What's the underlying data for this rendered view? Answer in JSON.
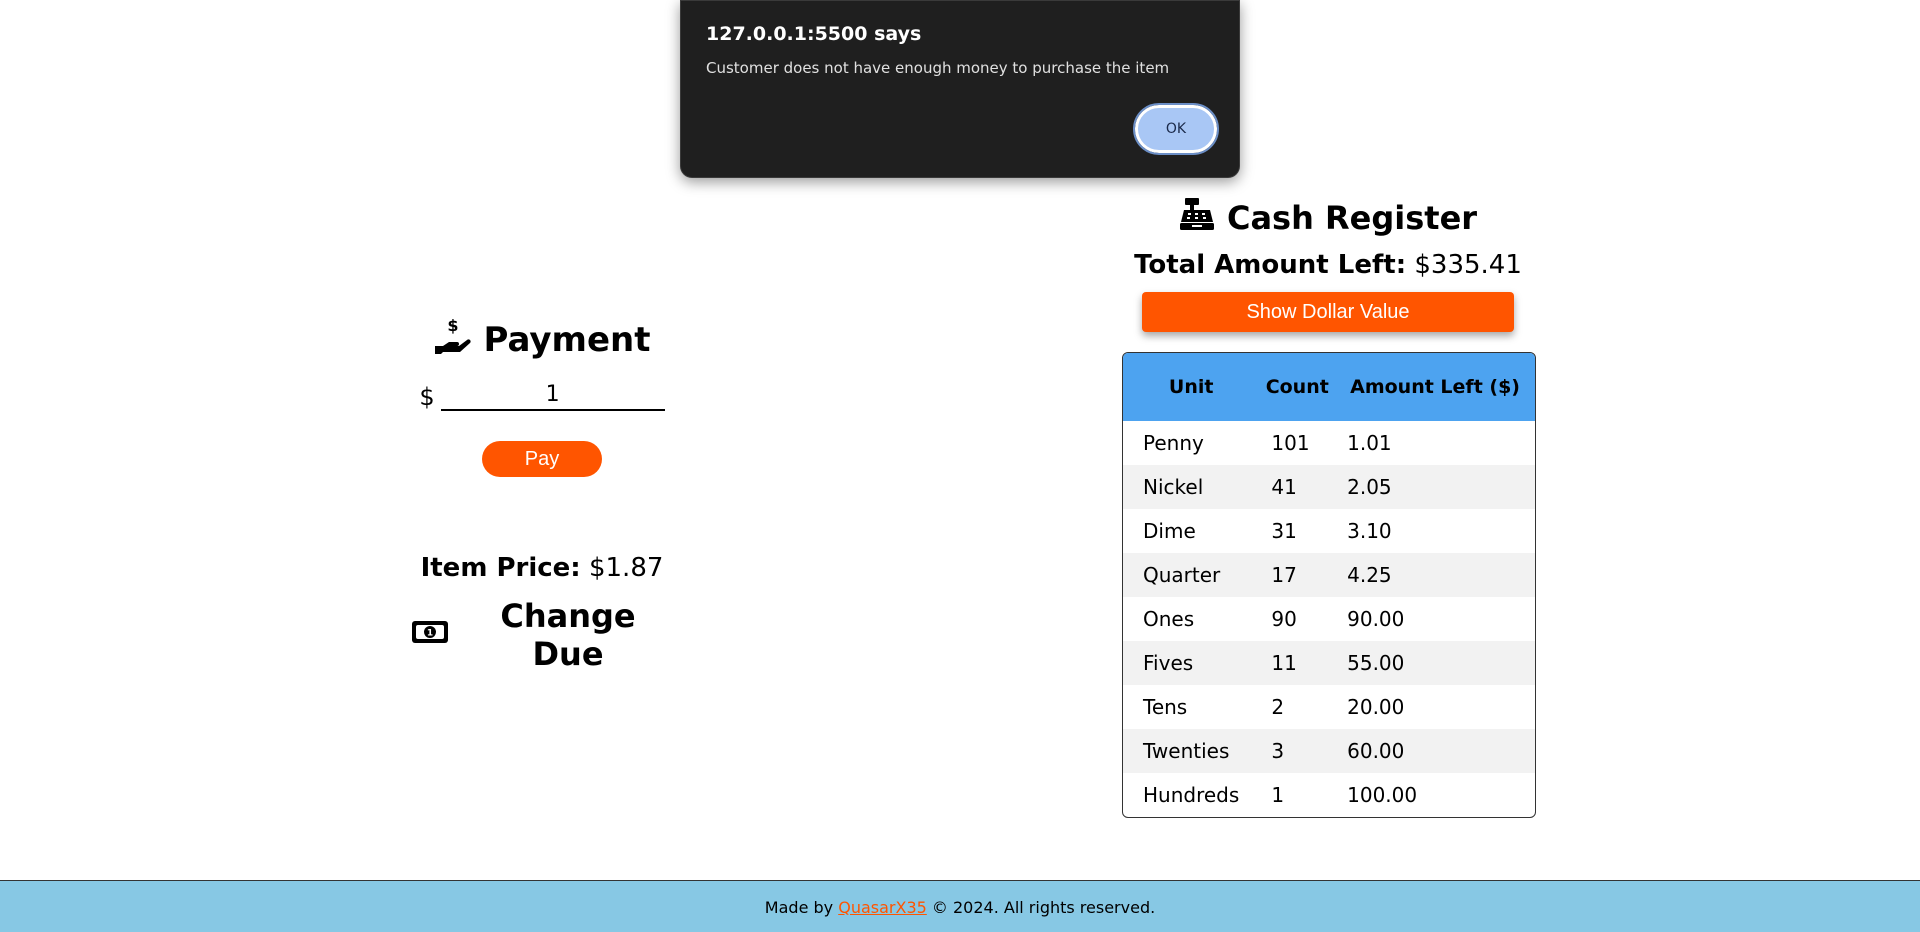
{
  "dialog": {
    "title": "127.0.0.1:5500 says",
    "message": "Customer does not have enough money to purchase the item",
    "ok_label": "OK"
  },
  "payment": {
    "title": "Payment",
    "icon": "hand-holding-dollar-icon",
    "currency_symbol": "$",
    "input_value": "1",
    "pay_label": "Pay",
    "item_price_label": "Item Price:",
    "item_price_value": "$1.87",
    "change_due_title": "Change Due",
    "change_icon": "money-bill-icon"
  },
  "register": {
    "title": "Cash Register",
    "icon": "cash-register-icon",
    "total_label": "Total Amount Left:",
    "total_value": "$335.41",
    "show_dollar_label": "Show Dollar Value",
    "headers": [
      "Unit",
      "Count",
      "Amount Left ($)"
    ],
    "rows": [
      {
        "unit": "Penny",
        "count": "101",
        "amount": "1.01"
      },
      {
        "unit": "Nickel",
        "count": "41",
        "amount": "2.05"
      },
      {
        "unit": "Dime",
        "count": "31",
        "amount": "3.10"
      },
      {
        "unit": "Quarter",
        "count": "17",
        "amount": "4.25"
      },
      {
        "unit": "Ones",
        "count": "90",
        "amount": "90.00"
      },
      {
        "unit": "Fives",
        "count": "11",
        "amount": "55.00"
      },
      {
        "unit": "Tens",
        "count": "2",
        "amount": "20.00"
      },
      {
        "unit": "Twenties",
        "count": "3",
        "amount": "60.00"
      },
      {
        "unit": "Hundreds",
        "count": "1",
        "amount": "100.00"
      }
    ]
  },
  "footer": {
    "prefix": "Made by",
    "author": "QuasarX35",
    "suffix": "© 2024. All rights reserved."
  },
  "colors": {
    "accent": "#ff5500",
    "table_header": "#4da3f0",
    "footer_bg": "#87c8e4",
    "dialog_bg": "#1f1f1f"
  }
}
